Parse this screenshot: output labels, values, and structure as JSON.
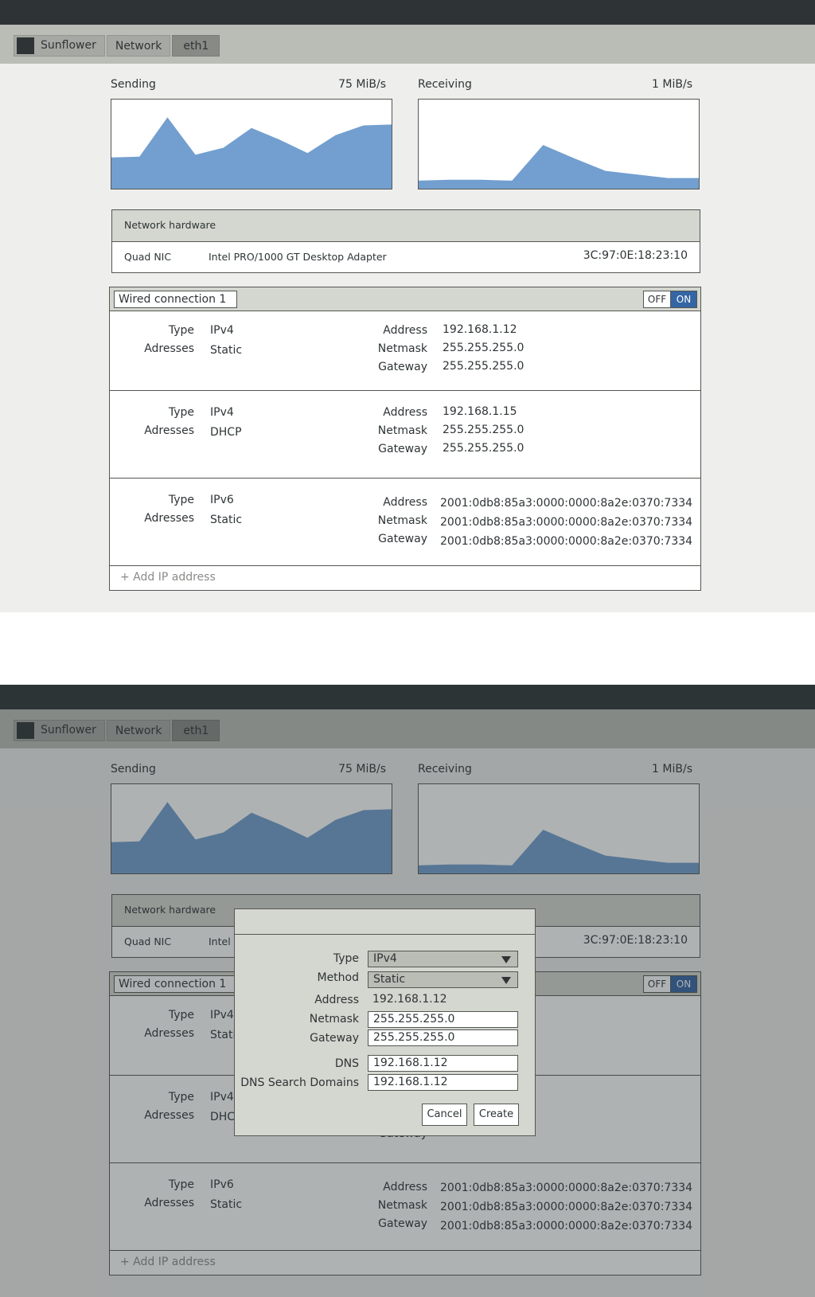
{
  "breadcrumb": [
    "Sunflower",
    "Network",
    "eth1"
  ],
  "sending": {
    "label": "Sending",
    "rate": "75 MiB/s",
    "points": [
      0.35,
      0.36,
      0.8,
      0.38,
      0.46,
      0.68,
      0.55,
      0.4,
      0.6,
      0.71,
      0.72
    ]
  },
  "receiving": {
    "label": "Receiving",
    "rate": "1 MiB/s",
    "points": [
      0.09,
      0.1,
      0.1,
      0.09,
      0.49,
      0.34,
      0.2,
      0.16,
      0.12,
      0.12
    ]
  },
  "hardware": {
    "title": "Network hardware",
    "device": "Quad NIC",
    "model": "Intel PRO/1000 GT Desktop Adapter",
    "mac": "3C:97:0E:18:23:10"
  },
  "connection": {
    "name": "Wired connection 1",
    "toggle_off": "OFF",
    "toggle_on": "ON",
    "entries": [
      {
        "type_label": "Type",
        "type": "IPv4",
        "addr_label": "Adresses",
        "method": "Static",
        "address_label": "Address",
        "address": "192.168.1.12",
        "netmask_label": "Netmask",
        "netmask": "255.255.255.0",
        "gateway_label": "Gateway",
        "gateway": "255.255.255.0"
      },
      {
        "type_label": "Type",
        "type": "IPv4",
        "addr_label": "Adresses",
        "method": "DHCP",
        "address_label": "Address",
        "address": "192.168.1.15",
        "netmask_label": "Netmask",
        "netmask": "255.255.255.0",
        "gateway_label": "Gateway",
        "gateway": "255.255.255.0"
      },
      {
        "type_label": "Type",
        "type": "IPv6",
        "addr_label": "Adresses",
        "method": "Static",
        "address_label": "Address",
        "address": "2001:0db8:85a3:0000:0000:8a2e:0370:7334",
        "netmask_label": "Netmask",
        "netmask": "2001:0db8:85a3:0000:0000:8a2e:0370:7334",
        "gateway_label": "Gateway",
        "gateway": "2001:0db8:85a3:0000:0000:8a2e:0370:7334"
      }
    ],
    "add_ip": "+ Add IP address"
  },
  "dialog": {
    "type_label": "Type",
    "type_value": "IPv4",
    "method_label": "Method",
    "method_value": "Static",
    "address_label": "Address",
    "address_value": "192.168.1.12",
    "netmask_label": "Netmask",
    "netmask_value": "255.255.255.0",
    "gateway_label": "Gateway",
    "gateway_value": "255.255.255.0",
    "dns_label": "DNS",
    "dns_value": "192.168.1.12",
    "dns_search_label": "DNS Search Domains",
    "dns_search_value": "192.168.1.12",
    "cancel": "Cancel",
    "create": "Create"
  },
  "colors": {
    "accent": "#3465a4",
    "graph_fill": "#729fcf",
    "dark": "#2e3436"
  }
}
